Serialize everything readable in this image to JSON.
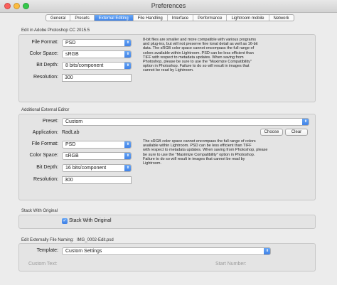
{
  "window": {
    "title": "Preferences"
  },
  "tabs": [
    "General",
    "Presets",
    "External Editing",
    "File Handling",
    "Interface",
    "Performance",
    "Lightroom mobile",
    "Network"
  ],
  "photoshop_section": {
    "title": "Edit in Adobe Photoshop CC 2015.5",
    "file_format_label": "File Format:",
    "file_format": "PSD",
    "color_space_label": "Color Space:",
    "color_space": "sRGB",
    "bit_depth_label": "Bit Depth:",
    "bit_depth": "8 bits/component",
    "resolution_label": "Resolution:",
    "resolution": "300",
    "note": "8-bit files are smaller and more compatible with various programs\nand plug-ins, but will not preserve fine tonal detail as well as 16-bit\ndata. The sRGB color space cannot encompass the full range of\ncolors available within Lightroom. PSD can be less efficient than\nTIFF with respect to metadata updates. When saving from\nPhotoshop, please be sure to use the \"Maximize Compatibility\"\noption in Photoshop. Failure to do so will result in images that\ncannot be read by Lightroom."
  },
  "additional_section": {
    "title": "Additional External Editor",
    "preset_label": "Preset:",
    "preset": "Custom",
    "application_label": "Application:",
    "application": "RadLab",
    "choose_label": "Choose",
    "clear_label": "Clear",
    "file_format_label": "File Format:",
    "file_format": "PSD",
    "color_space_label": "Color Space:",
    "color_space": "sRGB",
    "bit_depth_label": "Bit Depth:",
    "bit_depth": "16 bits/component",
    "resolution_label": "Resolution:",
    "resolution": "300",
    "note": "The sRGB color space cannot encompass the full range of colors\navailable within Lightroom. PSD can be less efficient than TIFF\nwith respect to metadata updates. When saving from Photoshop, please\nbe sure to use the \"Maximize Compatibility\" option in Photoshop.\nFailure to do so will result in images that cannot be read by\nLightroom."
  },
  "stack_section": {
    "title": "Stack With Original",
    "checkbox_label": "Stack With Original",
    "checked": true
  },
  "naming_section": {
    "title": "Edit Externally File Naming:",
    "example": "IMG_0002-Edit.psd",
    "template_label": "Template:",
    "template": "Custom Settings",
    "custom_text_label": "Custom Text:",
    "start_number_label": "Start Number:"
  },
  "colors": {
    "accent": "#3d7fe6"
  }
}
